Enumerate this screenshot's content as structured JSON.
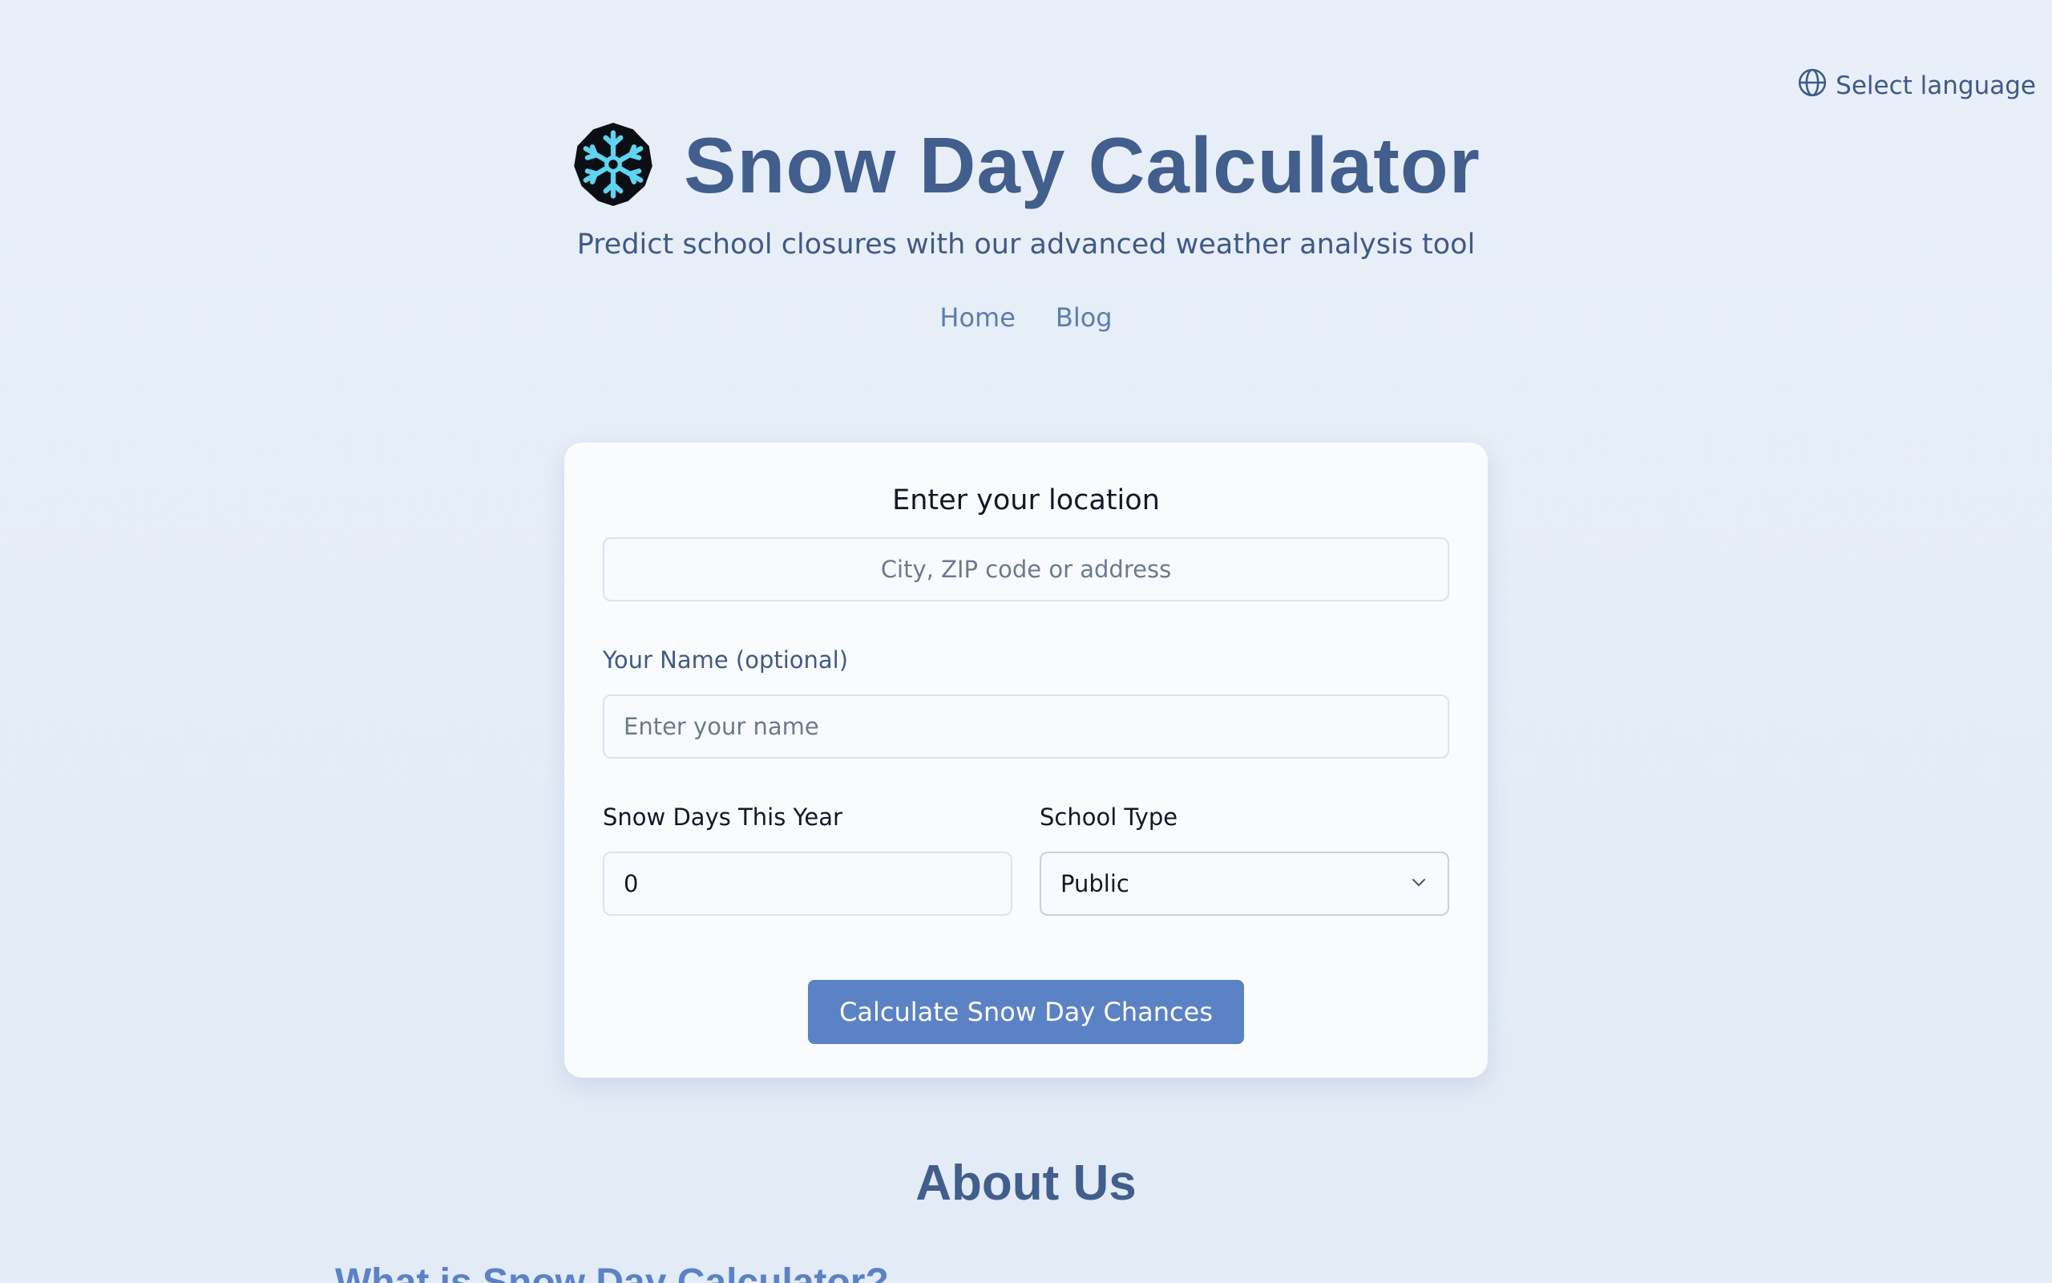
{
  "language": {
    "label": "Select language",
    "icon": "globe-icon"
  },
  "header": {
    "logo_icon": "snowflake-icon",
    "title": "Snow Day Calculator",
    "subtitle": "Predict school closures with our advanced weather analysis tool"
  },
  "nav": {
    "items": [
      {
        "label": "Home"
      },
      {
        "label": "Blog"
      }
    ]
  },
  "form": {
    "location_title": "Enter your location",
    "location_placeholder": "City, ZIP code or address",
    "name_label": "Your Name (optional)",
    "name_placeholder": "Enter your name",
    "snow_days_label": "Snow Days This Year",
    "snow_days_value": "0",
    "school_type_label": "School Type",
    "school_type_value": "Public",
    "submit_label": "Calculate Snow Day Chances"
  },
  "about": {
    "heading": "About Us",
    "subheading": "What is Snow Day Calculator?"
  },
  "colors": {
    "accent": "#5b82c4",
    "heading": "#415e8c",
    "snowflake": "#5fd4f0"
  }
}
